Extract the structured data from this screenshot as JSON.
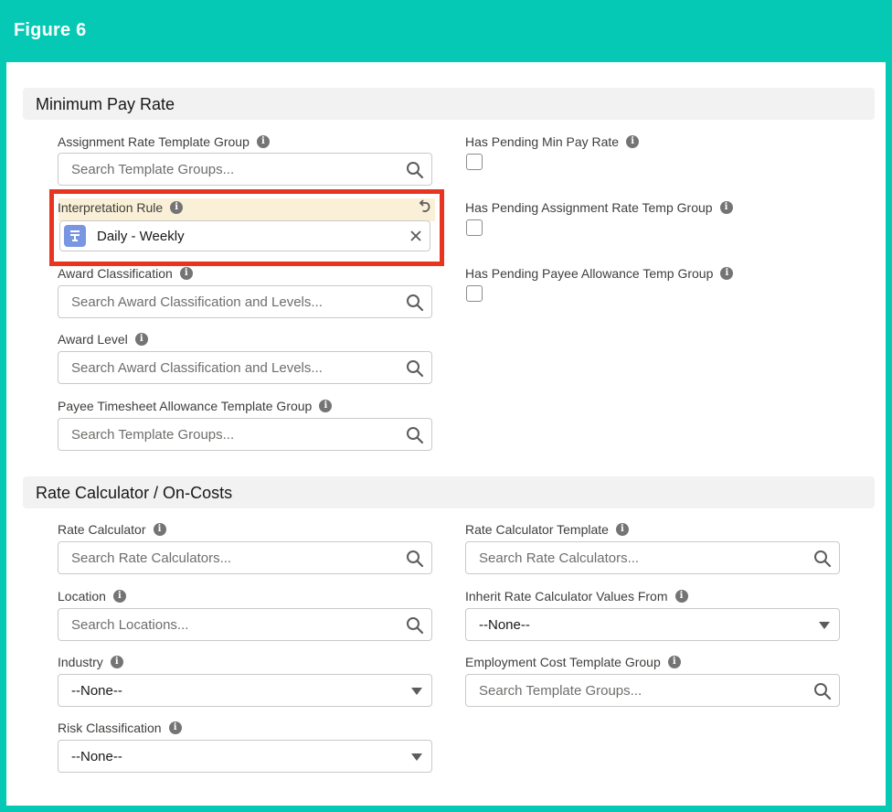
{
  "figure_title": "Figure 6",
  "sections": {
    "min_pay": "Minimum Pay Rate",
    "rate_calc": "Rate Calculator / On-Costs"
  },
  "fields": {
    "assignment_rate_template_group": {
      "label": "Assignment Rate Template Group",
      "placeholder": "Search Template Groups..."
    },
    "interpretation_rule": {
      "label": "Interpretation Rule",
      "value": "Daily - Weekly"
    },
    "award_classification": {
      "label": "Award Classification",
      "placeholder": "Search Award Classification and Levels..."
    },
    "award_level": {
      "label": "Award Level",
      "placeholder": "Search Award Classification and Levels..."
    },
    "payee_timesheet_allowance": {
      "label": "Payee Timesheet Allowance Template Group",
      "placeholder": "Search Template Groups..."
    },
    "has_pending_min_pay_rate": {
      "label": "Has Pending Min Pay Rate",
      "checked": false
    },
    "has_pending_assignment_rate": {
      "label": "Has Pending Assignment Rate Temp Group",
      "checked": false
    },
    "has_pending_payee_allowance": {
      "label": "Has Pending Payee Allowance Temp Group",
      "checked": false
    },
    "rate_calculator": {
      "label": "Rate Calculator",
      "placeholder": "Search Rate Calculators..."
    },
    "rate_calculator_template": {
      "label": "Rate Calculator Template",
      "placeholder": "Search Rate Calculators..."
    },
    "location": {
      "label": "Location",
      "placeholder": "Search Locations..."
    },
    "inherit_rate_calc": {
      "label": "Inherit Rate Calculator Values From",
      "value": "--None--"
    },
    "industry": {
      "label": "Industry",
      "value": "--None--"
    },
    "employment_cost_template_group": {
      "label": "Employment Cost Template Group",
      "placeholder": "Search Template Groups..."
    },
    "risk_classification": {
      "label": "Risk Classification",
      "value": "--None--"
    }
  },
  "info_glyph": "i",
  "colors": {
    "frame": "#05c9b4",
    "highlight_border": "#e9351f",
    "highlight_fill": "#faf0d7",
    "pill_icon": "#7996e3"
  },
  "icons": [
    "search-icon",
    "info-icon",
    "undo-icon",
    "clear-icon",
    "chevron-down-icon",
    "rule-icon"
  ]
}
